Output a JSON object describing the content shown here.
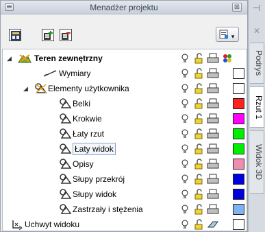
{
  "panel": {
    "title": "Menadżer projektu",
    "close": "⊠"
  },
  "toolbar": {
    "view_caret": "▼"
  },
  "tree": {
    "rows": [
      {
        "label": "Teren zewnętrzny",
        "color": ""
      },
      {
        "label": "Wymiary",
        "color": "#ffffff"
      },
      {
        "label": "Elementy użytkownika",
        "color": "#ffffff"
      },
      {
        "label": "Belki",
        "color": "#ff2020"
      },
      {
        "label": "Krokwie",
        "color": "#ff00ff"
      },
      {
        "label": "Łaty rzut",
        "color": "#00ee00"
      },
      {
        "label": "Łaty widok",
        "color": "#00ee00"
      },
      {
        "label": "Opisy",
        "color": "#f08cb0"
      },
      {
        "label": "Słupy przekrój",
        "color": "#0000dd"
      },
      {
        "label": "Słupy widok",
        "color": "#0000dd"
      },
      {
        "label": "Zastrzały i stężenia",
        "color": "#7fb3f0"
      },
      {
        "label": "Uchwyt widoku",
        "color": "#ffffff"
      }
    ]
  },
  "sidebar": {
    "pin": "⊣",
    "close": "✕",
    "tabs": [
      "Podrys",
      "Rzut 1",
      "Widok 3D"
    ]
  }
}
